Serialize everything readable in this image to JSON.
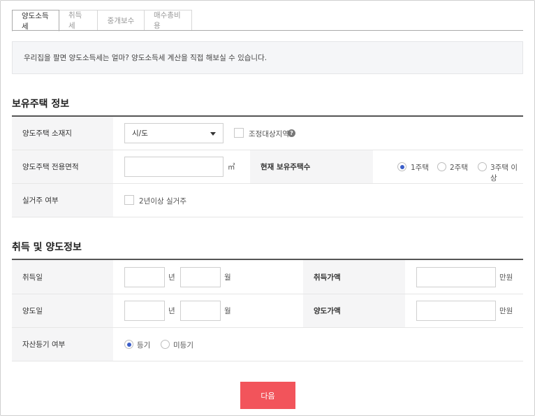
{
  "tabs": [
    {
      "label": "양도소득세",
      "active": true
    },
    {
      "label": "취득세",
      "active": false
    },
    {
      "label": "중개보수",
      "active": false
    },
    {
      "label": "매수총비용",
      "active": false
    }
  ],
  "notice": "우리집을 팔면 양도소득세는 얼마? 양도소득세 계산을 직접 해보실 수 있습니다.",
  "section1": {
    "title": "보유주택 정보",
    "location_label": "양도주택 소재지",
    "location_select": "시/도",
    "adjust_area_label": "조정대상지역",
    "area_label": "양도주택 전용면적",
    "area_unit": "㎡",
    "house_count_label": "현재 보유주택수",
    "house_count_options": [
      "1주택",
      "2주택",
      "3주택 이상"
    ],
    "residence_label": "실거주 여부",
    "residence_check_label": "2년이상 실거주"
  },
  "section2": {
    "title": "취득 및 양도정보",
    "acquire_date_label": "취득일",
    "transfer_date_label": "양도일",
    "year_unit": "년",
    "month_unit": "월",
    "acquire_price_label": "취득가액",
    "transfer_price_label": "양도가액",
    "price_unit": "만원",
    "registration_label": "자산등기 여부",
    "registration_options": [
      "등기",
      "미등기"
    ]
  },
  "next_button": "다음",
  "colors": {
    "accent_button": "#f2545b",
    "radio_selected": "#3b5ec8"
  }
}
